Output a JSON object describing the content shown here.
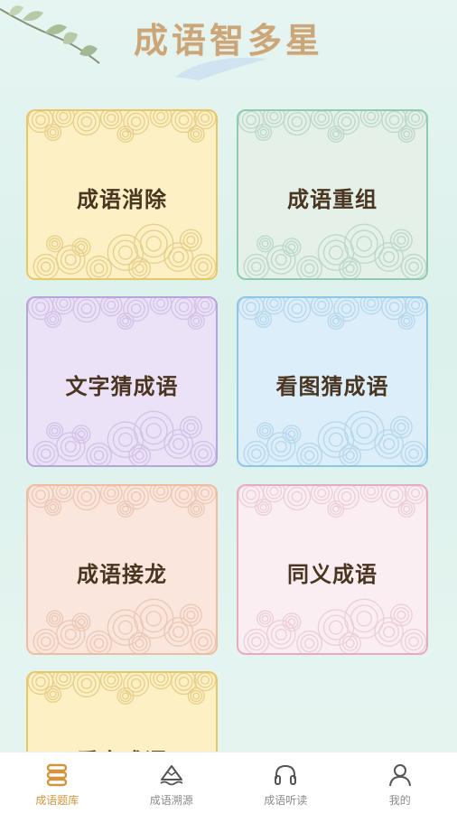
{
  "header": {
    "title": "成语智多星"
  },
  "cards": [
    {
      "label": "成语消除",
      "bg": "#fdf0c4",
      "border": "#e8c766",
      "ink": "#e7d08c"
    },
    {
      "label": "成语重组",
      "bg": "#e4f0e8",
      "border": "#8fcbb0",
      "ink": "#bdd9c9"
    },
    {
      "label": "文字猜成语",
      "bg": "#ece2f7",
      "border": "#b9a3dc",
      "ink": "#d3c3e8"
    },
    {
      "label": "看图猜成语",
      "bg": "#dbeefa",
      "border": "#8fc6e6",
      "ink": "#b8d8ec"
    },
    {
      "label": "成语接龙",
      "bg": "#fae6dc",
      "border": "#f0bca0",
      "ink": "#ecc9b7"
    },
    {
      "label": "同义成语",
      "bg": "#fbeef2",
      "border": "#e8aac0",
      "ink": "#ecd0d9"
    },
    {
      "label": "看字成语",
      "bg": "#fdf0c4",
      "border": "#e8c766",
      "ink": "#e7d08c"
    }
  ],
  "tabbar": {
    "active_color": "#d4953a",
    "items": [
      {
        "label": "成语题库",
        "icon": "stack-icon"
      },
      {
        "label": "成语溯源",
        "icon": "mountain-icon"
      },
      {
        "label": "成语听读",
        "icon": "headphones-icon"
      },
      {
        "label": "我的",
        "icon": "user-icon"
      }
    ]
  }
}
